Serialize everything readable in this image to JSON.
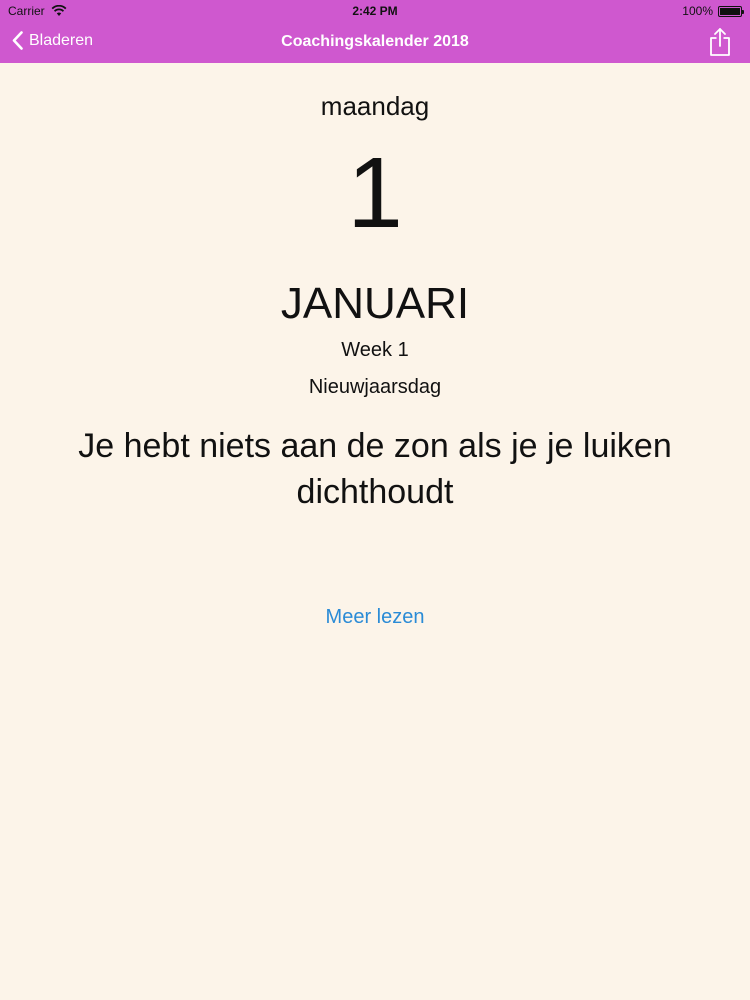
{
  "status_bar": {
    "carrier": "Carrier",
    "time": "2:42 PM",
    "battery": "100%",
    "battery_level": 1.0
  },
  "nav": {
    "back_label": "Bladeren",
    "title": "Coachingskalender 2018",
    "share_icon": "share-icon"
  },
  "calendar": {
    "weekday": "maandag",
    "day": "1",
    "month": "JANUARI",
    "week": "Week 1",
    "holiday": "Nieuwjaarsdag",
    "quote": "Je hebt niets aan de zon als je je luiken dichthoudt",
    "read_more": "Meer lezen"
  },
  "colors": {
    "nav_background": "#cf58cf",
    "page_background": "#fcf4e9",
    "link": "#2a8bd6"
  }
}
